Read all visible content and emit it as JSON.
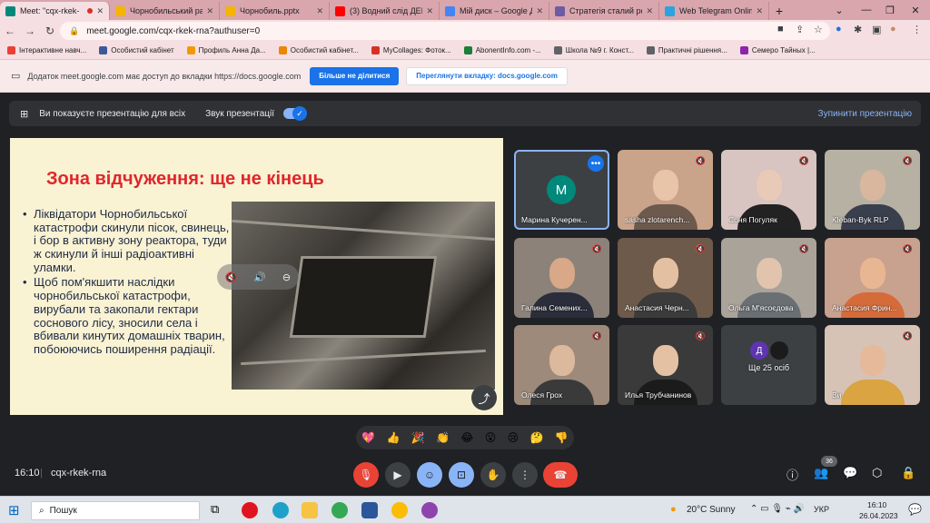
{
  "browser": {
    "tabs": [
      {
        "title": "Meet: \"cqx-rkek-",
        "color": "#00897b",
        "active": true,
        "recording": true
      },
      {
        "title": "Чорнобильський ра",
        "color": "#f4b400"
      },
      {
        "title": "Чорнобиль.pptx",
        "color": "#f4b400"
      },
      {
        "title": "(3) Водний слід ДЕП",
        "color": "#ff0000"
      },
      {
        "title": "Мій диск – Google Д",
        "color": "#4285f4"
      },
      {
        "title": "Стратегія сталий роз",
        "color": "#6b5ca5"
      },
      {
        "title": "Web Telegram Online",
        "color": "#2aa3df"
      }
    ],
    "new_tab": "+",
    "url": "meet.google.com/cqx-rkek-rna?authuser=0",
    "bookmarks": [
      {
        "label": "Інтерактивне навч...",
        "color": "#e94235"
      },
      {
        "label": "Особистий кабінет",
        "color": "#3b5998"
      },
      {
        "label": "Профиль Анна Да...",
        "color": "#f29900"
      },
      {
        "label": "Особистий кабінет...",
        "color": "#ea8600"
      },
      {
        "label": "MyCollages: Фоток...",
        "color": "#d93025"
      },
      {
        "label": "AbonentInfo.com -...",
        "color": "#188038"
      },
      {
        "label": "Школа №9 г. Конст...",
        "color": "#5f6368"
      },
      {
        "label": "Практичні рішення...",
        "color": "#5f6368"
      },
      {
        "label": "Семеро Тайных |...",
        "color": "#8e24aa"
      }
    ],
    "window_controls": [
      "⌄",
      "—",
      "❐",
      "✕"
    ]
  },
  "notification": {
    "text": "Додаток meet.google.com має доступ до вкладки https://docs.google.com",
    "stop_sharing": "Більше не ділитися",
    "view_tab": "Переглянути вкладку: docs.google.com"
  },
  "presentation_bar": {
    "presenting_text": "Ви показуєте презентацію для всіх",
    "audio_label": "Звук презентації",
    "stop_label": "Зупинити презентацію"
  },
  "slide": {
    "title": "Зона відчуження: ще не кінець",
    "bullets": [
      "Ліквідатори Чорнобильської катастрофи скинули пісок, свинець, і бор в активну зону реактора, туди ж скинули й інші радіоактивні уламки.",
      "Щоб пом'якшити наслідки чорнобильської катастрофи, вирубали та закопали гектари соснового лісу, зносили села і вбивали кинутих домашніх тварин, побоюючись поширення радіації."
    ]
  },
  "participants": [
    {
      "name": "Марина Кучерен...",
      "avatar_letter": "М",
      "avatar_color": "#00897b",
      "bg": "#3c4043",
      "highlight": true
    },
    {
      "name": "sasha zlotarench...",
      "bg": "#c9a38a",
      "face": "#e8c4a8",
      "body": "#6d5a4d"
    },
    {
      "name": "Соня Погуляк",
      "bg": "#d8c4c0",
      "face": "#e9c9b7",
      "body": "#222222"
    },
    {
      "name": "Kleban-Byk RLP",
      "bg": "#b7b1a3",
      "face": "#d9b79f",
      "body": "#3a3f4d"
    },
    {
      "name": "Галина Семених...",
      "bg": "#8c8279",
      "face": "#d8a888",
      "body": "#2b2d3a"
    },
    {
      "name": "Анастасия Черн...",
      "bg": "#6e5a4a",
      "face": "#e3c0a2",
      "body": "#3b3b3b"
    },
    {
      "name": "Ольга М'ясоєдова",
      "bg": "#a9a39a",
      "face": "#e2c3ad",
      "body": "#6a6f74"
    },
    {
      "name": "Анастасия Фрин...",
      "bg": "#c8a28e",
      "face": "#e8b693",
      "body": "#d66b3a"
    },
    {
      "name": "Олеся Грох",
      "bg": "#9e8a7a",
      "face": "#dcb89c",
      "body": "#3a3a3a"
    },
    {
      "name": "Илья Трубчанинов",
      "bg": "#3a3a3a",
      "face": "#e3c1a2",
      "body": "#1b1b1b"
    },
    {
      "name": "Ще 25 осіб",
      "bg": "#3c4043",
      "others": true,
      "avatar_letter": "Д"
    },
    {
      "name": "Ви",
      "bg": "#d7c3b5",
      "face": "#e6b99a",
      "body": "#d9a441"
    }
  ],
  "reactions": [
    "💖",
    "👍",
    "🎉",
    "👏",
    "😂",
    "😮",
    "😢",
    "🤔",
    "👎"
  ],
  "meeting": {
    "time": "16:10",
    "code": "cqx-rkek-rna",
    "people_count": "36"
  },
  "taskbar": {
    "search_placeholder": "Пошук",
    "weather": "20°C  Sunny",
    "lang": "УКР",
    "time": "16:10",
    "date": "26.04.2023"
  },
  "colors": {
    "accent": "#1a73e8",
    "end_call": "#ea4335",
    "mic_off": "#ea4335"
  }
}
